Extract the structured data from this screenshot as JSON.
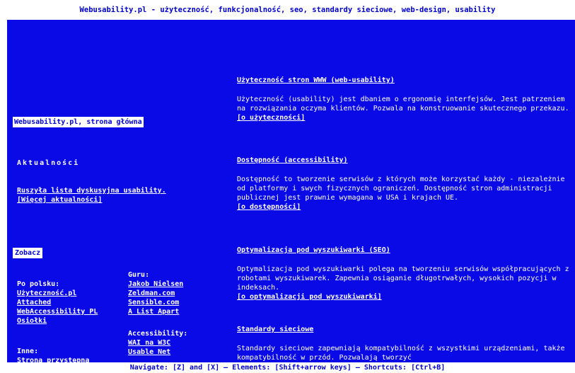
{
  "header": {
    "title": "Webusability.pl - użyteczność, funkcjonalność, seo, standardy sieciowe, web-design, usability"
  },
  "sidebar": {
    "home_link": "Webusability.pl, strona główna",
    "news": {
      "heading": "Aktualności",
      "item_link": "Ruszyła lista dyskusyjna usability.",
      "more_link": "[Więcej aktualności]"
    },
    "see": {
      "heading": "Zobacz",
      "polish": {
        "label": "Po polsku:",
        "links": [
          "Użyteczność.pl",
          "Attached",
          "WebAccessibility PL",
          "Osiołki"
        ]
      },
      "gurus": {
        "label": "Guru:",
        "links": [
          "Jakob Nielsen",
          "Zeldman.com",
          "Sensible.com",
          "A List Apart"
        ]
      },
      "accessibility": {
        "label": "Accessibility:",
        "links": [
          "WAI na W3C",
          "Usable Net"
        ]
      },
      "other": {
        "label": "Inne:",
        "partial_link": "Strona przystępna"
      }
    }
  },
  "main": {
    "sections": [
      {
        "title": "Użyteczność stron WWW (web-usability)",
        "body": "Użyteczność (usability) jest dbaniem o ergonomię interfejsów. Jest patrzeniem na rozwiązania oczyma klientów. Pozwala na konstruowanie skutecznego przekazu.",
        "more": "[o użyteczności]"
      },
      {
        "title": "Dostępność (accessibility)",
        "body": "Dostępność to tworzenie serwisów z których może korzystać każdy - niezależnie od platformy i swych fizycznych ograniczeń. Dostępność stron administracji publicznej jest prawnie wymagana w USA i krajach UE.",
        "more": "[o dostępności]"
      },
      {
        "title": "Optymalizacja pod wyszukiwarki (SEO)",
        "body": "Optymalizacja pod wyszukiwarki polega na tworzeniu serwisów współpracujących z robotami wyszukiwarek. Zapewnia osiąganie długotrwałych, wysokich pozycji w indeksach.",
        "more": "[o optymalizacji pod wyszukiwarki]"
      },
      {
        "title": "Standardy sieciowe",
        "body": "Standardy sieciowe zapewniają kompatybilność z wszystkimi urządzeniami, także kompatybilność w przód. Pozwalają tworzyć",
        "more": ""
      }
    ]
  },
  "footer": {
    "hint": "Navigate: [Z] and [X] — Elements: [Shift+arrow keys] — Shortcuts: [Ctrl+B]"
  },
  "colors": {
    "background": "#0a0ae6",
    "text": "#ffffff",
    "chrome": "#ffffff",
    "accent_text": "#0000cc"
  }
}
